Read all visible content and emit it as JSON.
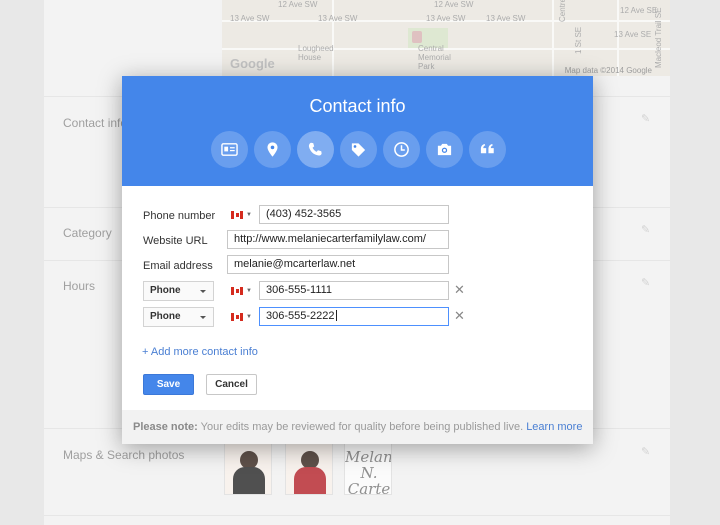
{
  "map": {
    "labels": [
      "12 Ave SW",
      "12 Ave SW",
      "13 Ave SW",
      "13 Ave SW",
      "13 Ave SW",
      "13 Ave SW",
      "12 Ave SE",
      "13 Ave SE",
      "Lougheed House",
      "Central Memorial Park",
      "Centre St S",
      "1 St SE",
      "Macleod Trail SE"
    ],
    "watermark": "Google",
    "attribution": "Map data ©2014 Google"
  },
  "sections": {
    "contact": "Contact info",
    "category": "Category",
    "hours": "Hours",
    "photos": "Maps & Search photos"
  },
  "photos": {
    "logo_text": "Melani N. Carte"
  },
  "dialog": {
    "title": "Contact info",
    "categories": [
      {
        "icon": "id-card-icon",
        "active": false
      },
      {
        "icon": "location-pin-icon",
        "active": false
      },
      {
        "icon": "phone-icon",
        "active": true
      },
      {
        "icon": "tag-icon",
        "active": false
      },
      {
        "icon": "clock-icon",
        "active": false
      },
      {
        "icon": "camera-icon",
        "active": false
      },
      {
        "icon": "quote-icon",
        "active": false
      }
    ],
    "fields": {
      "phone_label": "Phone number",
      "phone_value": "(403) 452-3565",
      "website_label": "Website URL",
      "website_value": "http://www.melaniecarterfamilylaw.com/",
      "email_label": "Email address",
      "email_value": "melanie@mcarterlaw.net"
    },
    "extra_rows": [
      {
        "type": "Phone",
        "value": "306-555-1111"
      },
      {
        "type": "Phone",
        "value": "306-555-2222"
      }
    ],
    "add_more": "+ Add more contact info",
    "save_label": "Save",
    "cancel_label": "Cancel",
    "note_bold": "Please note:",
    "note_text": " Your edits may be reviewed for quality before being published live. ",
    "note_link": "Learn more"
  }
}
